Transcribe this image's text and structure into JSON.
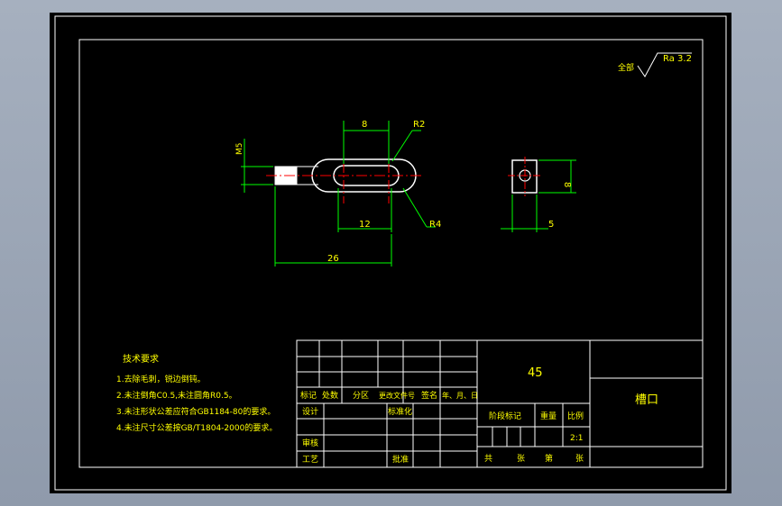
{
  "colors": {
    "background": "#000000",
    "frame": "#ffffff",
    "outline": "#ffffff",
    "dimension": "#00ff00",
    "centerline": "#ff0000",
    "text": "#ffff00",
    "leader": "#00ff00"
  },
  "roughness": {
    "prefix": "全部",
    "value": "Ra 3.2"
  },
  "dimensions": {
    "slot_width": "8",
    "arc_radius_top": "R2",
    "thread": "M5",
    "slot_length": "12",
    "arc_radius_bottom": "R4",
    "overall_length": "26",
    "side_height": "8",
    "side_width": "5"
  },
  "technical_requirements": {
    "title": "技术要求",
    "items": [
      "1.去除毛刺，锐边倒钝。",
      "2.未注倒角C0.5,未注圆角R0.5。",
      "3.未注形状公差应符合GB1184-80的要求。",
      "4.未注尺寸公差按GB/T1804-2000的要求。"
    ]
  },
  "title_block": {
    "material": "45",
    "part_name": "槽口",
    "header_row": [
      "标记",
      "处数",
      "分区",
      "更改文件号",
      "签名",
      "年、月、日"
    ],
    "design": "设计",
    "standardization": "标准化",
    "review": "审核",
    "process": "工艺",
    "approve": "批准",
    "stage_mark": "阶段标记",
    "weight": "重量",
    "scale_label": "比例",
    "scale_value": "2:1",
    "total": "共",
    "sheets": "张",
    "sheet_no": "第",
    "sheet_unit": "张"
  }
}
